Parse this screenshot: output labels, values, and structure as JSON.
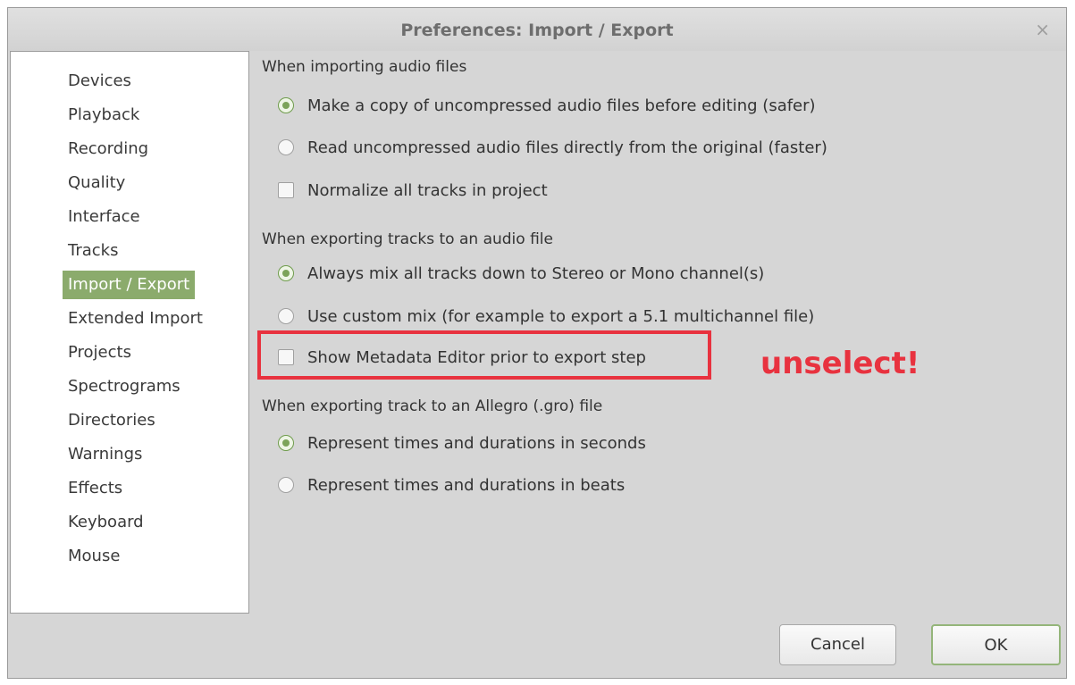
{
  "window": {
    "title": "Preferences: Import / Export",
    "close_glyph": "×"
  },
  "sidebar": {
    "items": [
      {
        "label": "Devices"
      },
      {
        "label": "Playback"
      },
      {
        "label": "Recording"
      },
      {
        "label": "Quality"
      },
      {
        "label": "Interface"
      },
      {
        "label": "Tracks"
      },
      {
        "label": "Import / Export",
        "selected": true
      },
      {
        "label": "Extended Import"
      },
      {
        "label": "Projects"
      },
      {
        "label": "Spectrograms"
      },
      {
        "label": "Directories"
      },
      {
        "label": "Warnings"
      },
      {
        "label": "Effects"
      },
      {
        "label": "Keyboard"
      },
      {
        "label": "Mouse"
      }
    ]
  },
  "importing": {
    "title": "When importing audio files",
    "copy_option": "Make a copy of uncompressed audio files before editing (safer)",
    "read_option": "Read uncompressed audio files directly from the original (faster)",
    "normalize_option": "Normalize all tracks in project",
    "selected": "copy_option",
    "normalize_checked": false
  },
  "exporting": {
    "title": "When exporting tracks to an audio file",
    "mix_option": "Always mix all tracks down to Stereo or Mono channel(s)",
    "custom_option": "Use custom mix (for example to export a 5.1 multichannel file)",
    "metadata_option": "Show Metadata Editor prior to export step",
    "selected": "mix_option",
    "metadata_checked": false
  },
  "allegro": {
    "title": "When exporting track to an Allegro (.gro) file",
    "seconds_option": "Represent times and durations in seconds",
    "beats_option": "Represent times and durations in beats",
    "selected": "seconds_option"
  },
  "annotation": {
    "text": "unselect!",
    "color": "#e8323f"
  },
  "buttons": {
    "cancel": "Cancel",
    "ok": "OK"
  },
  "colors": {
    "accent": "#8bab6c",
    "window_bg": "#d6d6d6"
  }
}
